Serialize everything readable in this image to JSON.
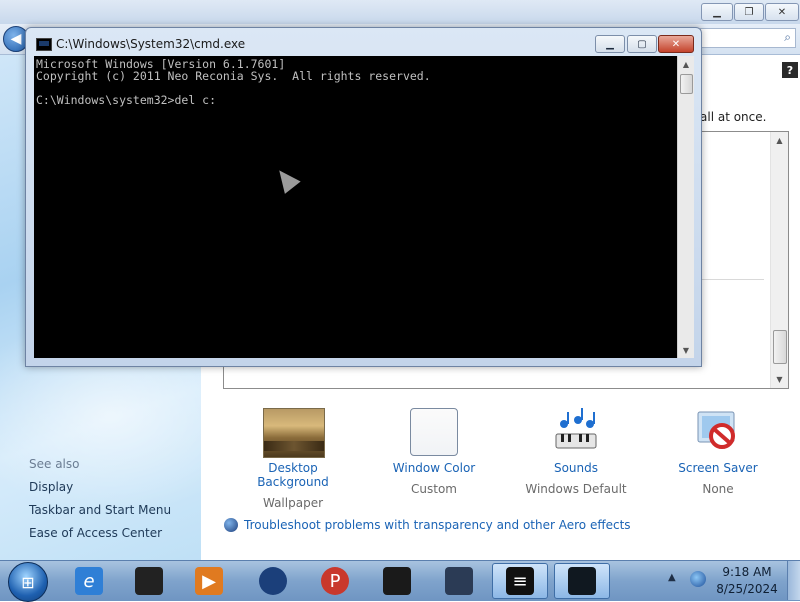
{
  "personalization": {
    "partial_text": "all at once.",
    "see_also": "See also",
    "sidebar_links": [
      "Display",
      "Taskbar and Start Menu",
      "Ease of Access Center"
    ],
    "options": [
      {
        "label": "Desktop Background",
        "sub": "Wallpaper",
        "icon": "wallpaper-icon"
      },
      {
        "label": "Window Color",
        "sub": "Custom",
        "icon": "window-color-icon"
      },
      {
        "label": "Sounds",
        "sub": "Windows Default",
        "icon": "sounds-icon"
      },
      {
        "label": "Screen Saver",
        "sub": "None",
        "icon": "screen-saver-icon"
      }
    ],
    "aero_link": "Troubleshoot problems with transparency and other Aero effects",
    "help_label": "?"
  },
  "cmd": {
    "title": "C:\\Windows\\System32\\cmd.exe",
    "lines": [
      "Microsoft Windows [Version 6.1.7601]",
      "Copyright (c) 2011 Neo Reconia Sys.  All rights reserved.",
      "",
      "C:\\Windows\\system32>del c:"
    ]
  },
  "taskbar": {
    "items": [
      {
        "name": "internet-explorer-icon",
        "color": "#2f7fd6"
      },
      {
        "name": "app-dark-icon",
        "color": "#222222"
      },
      {
        "name": "media-player-icon",
        "color": "#e07a20"
      },
      {
        "name": "globe-app-icon",
        "color": "#1b3f7a"
      },
      {
        "name": "paint-app-icon",
        "color": "#c9382c"
      },
      {
        "name": "monitor-app-icon",
        "color": "#1a1a1a"
      },
      {
        "name": "display-app-icon",
        "color": "#2b3b55"
      },
      {
        "name": "cmd-taskbar-icon",
        "color": "#111111"
      },
      {
        "name": "cmd-window-taskbar-icon",
        "color": "#101820"
      }
    ],
    "time": "9:18 AM",
    "date": "8/25/2024"
  }
}
